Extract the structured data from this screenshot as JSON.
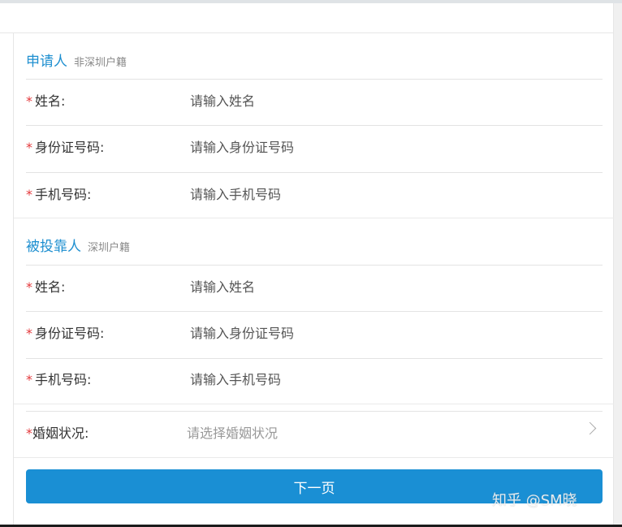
{
  "applicant": {
    "title": "申请人",
    "subtitle": "非深圳户籍",
    "fields": [
      {
        "label": "姓名:",
        "placeholder": "请输入姓名"
      },
      {
        "label": "身份证号码:",
        "placeholder": "请输入身份证号码"
      },
      {
        "label": "手机号码:",
        "placeholder": "请输入手机号码"
      }
    ]
  },
  "sponsor": {
    "title": "被投靠人",
    "subtitle": "深圳户籍",
    "fields": [
      {
        "label": "姓名:",
        "placeholder": "请输入姓名"
      },
      {
        "label": "身份证号码:",
        "placeholder": "请输入身份证号码"
      },
      {
        "label": "手机号码:",
        "placeholder": "请输入手机号码"
      }
    ]
  },
  "marital": {
    "label": "婚姻状况:",
    "placeholder": "请选择婚姻状况"
  },
  "required_mark": "*",
  "next_button": "下一页",
  "watermark": "知乎 @SM晓"
}
